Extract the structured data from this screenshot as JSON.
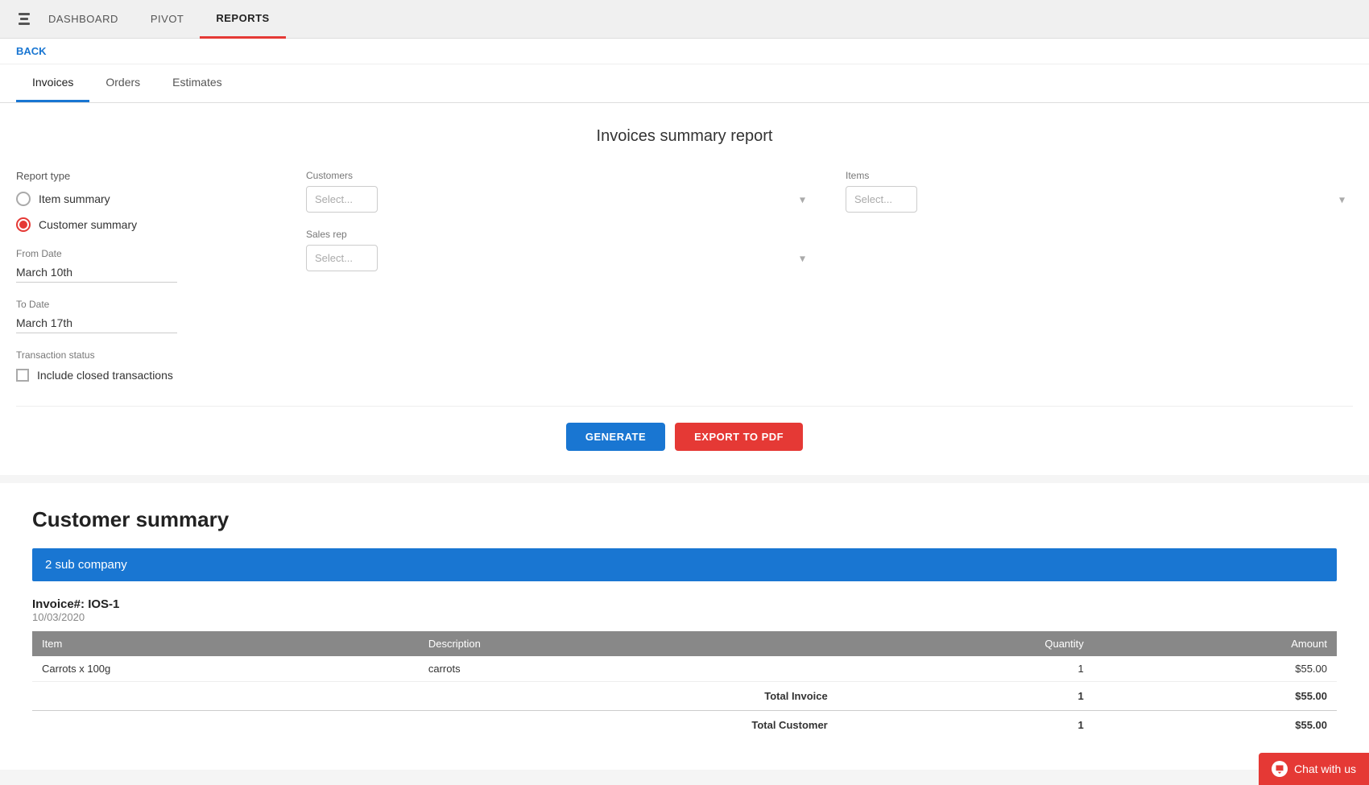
{
  "nav": {
    "logo_icon": "bar-chart-icon",
    "items": [
      {
        "label": "DASHBOARD",
        "active": false
      },
      {
        "label": "PIVOT",
        "active": false
      },
      {
        "label": "REPORTS",
        "active": true
      }
    ]
  },
  "back_label": "BACK",
  "tabs": [
    {
      "label": "Invoices",
      "active": true
    },
    {
      "label": "Orders",
      "active": false
    },
    {
      "label": "Estimates",
      "active": false
    }
  ],
  "form": {
    "title": "Invoices summary report",
    "report_type_label": "Report type",
    "radio_options": [
      {
        "label": "Item summary",
        "selected": false
      },
      {
        "label": "Customer summary",
        "selected": true
      }
    ],
    "from_date_label": "From Date",
    "from_date_value": "March 10th",
    "to_date_label": "To Date",
    "to_date_value": "March 17th",
    "transaction_status_label": "Transaction status",
    "include_closed_label": "Include closed transactions",
    "customers_label": "Customers",
    "customers_placeholder": "Select...",
    "items_label": "Items",
    "items_placeholder": "Select...",
    "sales_rep_label": "Sales rep",
    "sales_rep_placeholder": "Select...",
    "generate_label": "GENERATE",
    "export_label": "EXPORT TO PDF"
  },
  "results": {
    "title": "Customer summary",
    "group_label": "2 sub company",
    "invoice_number": "Invoice#: IOS-1",
    "invoice_date": "10/03/2020",
    "table": {
      "headers": [
        "Item",
        "Description",
        "Quantity",
        "Amount"
      ],
      "rows": [
        {
          "item": "Carrots x 100g",
          "description": "carrots",
          "quantity": "1",
          "amount": "$55.00"
        }
      ],
      "total_invoice_label": "Total Invoice",
      "total_invoice_qty": "1",
      "total_invoice_amount": "$55.00",
      "total_customer_label": "Total Customer",
      "total_customer_qty": "1",
      "total_customer_amount": "$55.00"
    }
  },
  "chat": {
    "label": "Chat with us"
  }
}
